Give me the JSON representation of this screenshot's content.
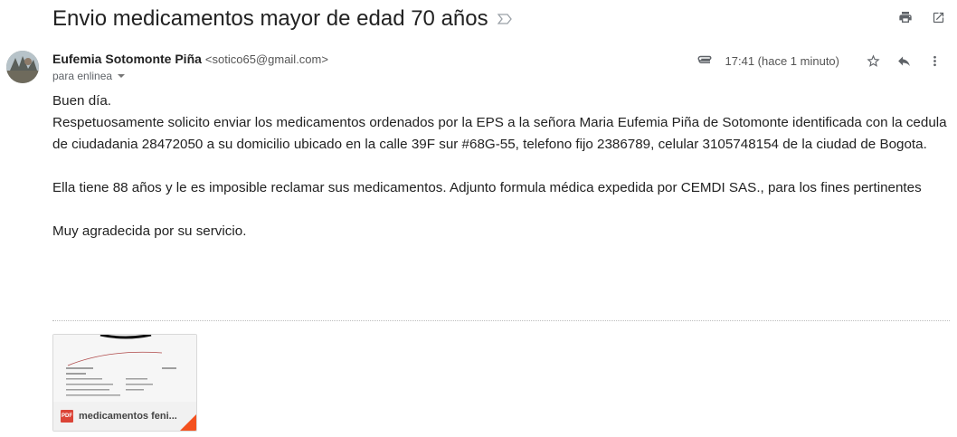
{
  "email": {
    "subject": "Envio medicamentos mayor de edad 70 años",
    "sender": {
      "name": "Eufemia Sotomonte Piña",
      "email": "<sotico65@gmail.com>",
      "to": "para enlinea"
    },
    "timestamp": "17:41 (hace 1 minuto)",
    "body": {
      "greeting": "Buen día.",
      "para1": "Respetuosamente solicito enviar los medicamentos ordenados por la EPS a la señora Maria Eufemia Piña de Sotomonte identificada con la cedula de ciudadania 28472050 a su domicilio ubicado en la calle 39F sur #68G-55, telefono fijo 2386789, celular 3105748154 de la ciudad de Bogota.",
      "para2": "Ella tiene 88 años y le es imposible reclamar sus medicamentos. Adjunto formula médica expedida por CEMDI SAS., para los fines pertinentes",
      "closing": "Muy agradecida por su servicio."
    },
    "attachment": {
      "badge": "PDF",
      "filename": "medicamentos feni..."
    }
  },
  "icons": {
    "important": "label-important-outline-icon",
    "print": "print-icon",
    "open_new_window": "open-in-new-window-icon",
    "attachment": "paperclip-icon",
    "star": "star-outline-icon",
    "reply": "reply-icon",
    "more": "more-vertical-icon",
    "details": "chevron-down-icon"
  },
  "colors": {
    "text": "#222222",
    "secondary_text": "#5f6368",
    "icon": "#5f6368",
    "pdf_red": "#db4437",
    "corner_orange": "#f4511e"
  }
}
